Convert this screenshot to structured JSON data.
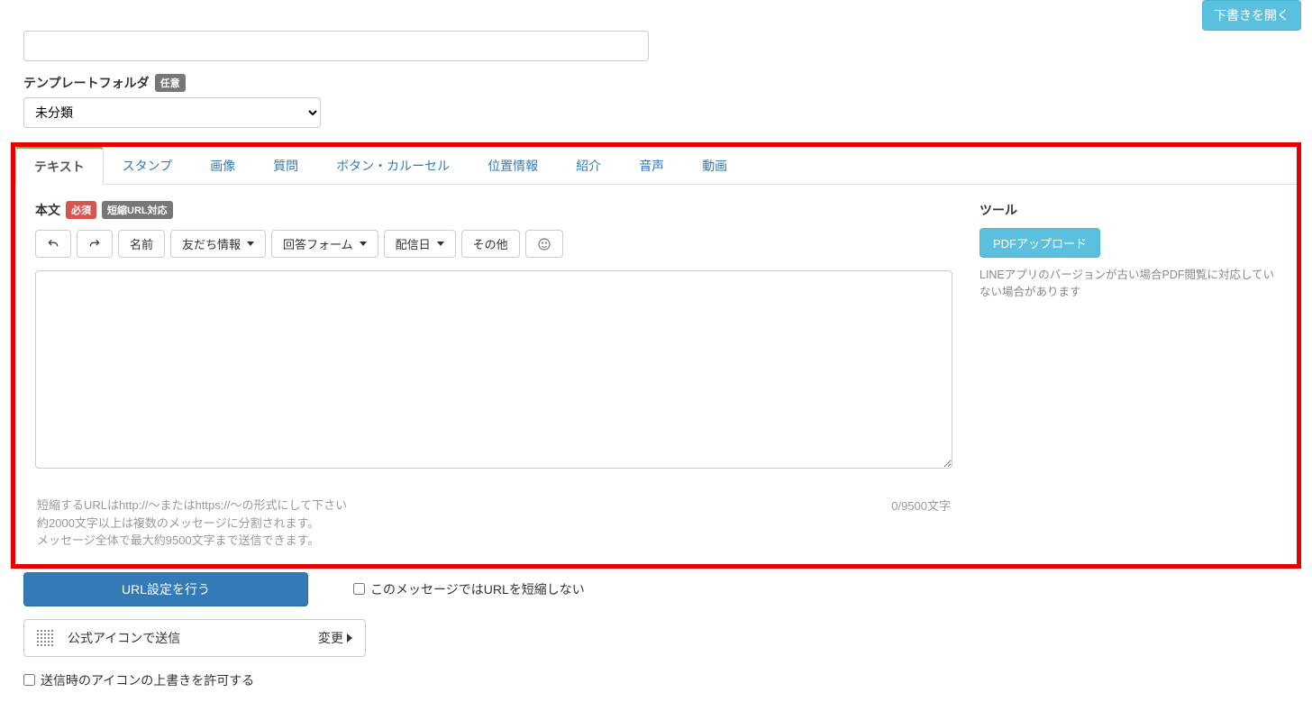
{
  "header": {
    "open_draft_label": "下書きを開く"
  },
  "template_folder": {
    "label": "テンプレートフォルダ",
    "badge": "任意",
    "selected": "未分類"
  },
  "tabs": [
    "テキスト",
    "スタンプ",
    "画像",
    "質問",
    "ボタン・カルーセル",
    "位置情報",
    "紹介",
    "音声",
    "動画"
  ],
  "body": {
    "section_label": "本文",
    "required_badge": "必須",
    "short_url_badge": "短縮URL対応",
    "toolbar": {
      "name": "名前",
      "friend_info": "友だち情報",
      "answer_form": "回答フォーム",
      "delivery_date": "配信日",
      "other": "その他"
    },
    "char_count_label": "0/9500文字",
    "hint1": "短縮するURLはhttp://～またはhttps://～の形式にして下さい",
    "hint2": "約2000文字以上は複数のメッセージに分割されます。",
    "hint3": "メッセージ全体で最大約9500文字まで送信できます。",
    "url_settings_btn": "URL設定を行う",
    "no_shorten_label": "このメッセージではURLを短縮しない",
    "icon_send_label": "公式アイコンで送信",
    "change_label": "変更",
    "allow_override_label": "送信時のアイコンの上書きを許可する"
  },
  "side": {
    "tool_label": "ツール",
    "pdf_upload_label": "PDFアップロード",
    "pdf_note": "LINEアプリのバージョンが古い場合PDF閲覧に対応していない場合があります"
  }
}
